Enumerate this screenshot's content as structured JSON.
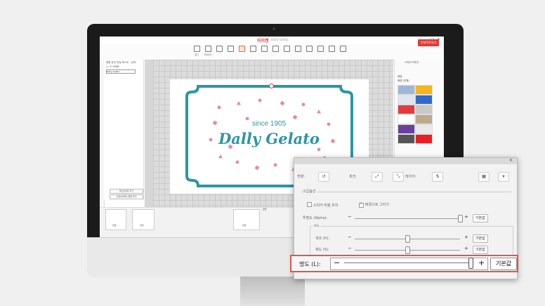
{
  "app": {
    "logo": "아이캔",
    "title": "Dally Gelato",
    "toolbar": [
      "열기",
      "저장하기",
      "",
      "",
      "",
      "",
      "",
      "",
      "",
      "",
      "",
      "",
      "",
      ""
    ],
    "active_tool": 4,
    "zoom_lines": [
      "",
      "",
      ""
    ],
    "save_button": "인쇄주문하기",
    "window_buttons": [
      "–",
      "□",
      "✕"
    ]
  },
  "left_panel": {
    "header": "명함 앞뒤 편집 텍스트 · 입력",
    "row1": "1 / 2 스티커",
    "field": "Dally Gelato",
    "btn1": "텍스트상자 추가",
    "btn2": "사진(이미지) 파일 추가"
  },
  "design": {
    "since": "since 1905",
    "brand": "Dally Gelato",
    "border_color": "#2a96a5",
    "confetti_color": "#e58aa8"
  },
  "right_panel": {
    "tab": "스티커 꾸미기",
    "section": "배경",
    "sub": "배경 (전체)"
  },
  "bottom": {
    "label_center": "앞면",
    "pages": [
      {
        "label": "앞면"
      },
      {
        "label": "뒷면"
      },
      {
        "label": "앞면"
      }
    ]
  },
  "dialog": {
    "title": "",
    "tools": [
      {
        "label": "방향:",
        "glyph": "↺"
      },
      {
        "label": "회전:",
        "glyph": "⤢"
      },
      {
        "label": "",
        "glyph": "⤡"
      },
      {
        "label": "레이어:",
        "glyph": "⇅"
      },
      {
        "label": "",
        "glyph": "▦"
      },
      {
        "label": "",
        "glyph": "▾"
      }
    ],
    "group": "고급옵션",
    "cb1": "스티커 비율 유지",
    "cb2": "배경으로 그리기",
    "opacity_label": "투명도 (Alpha):",
    "hsl_title": "HSL",
    "hue_label": "색조 (H):",
    "sat_label": "채도 (S):",
    "light_label": "명도 (L):",
    "default_btn": "기본값",
    "minus": "−",
    "plus": "+",
    "opacity_value": 1.0,
    "hue_value": 0.5,
    "sat_value": 0.5,
    "light_value": 1.0
  }
}
